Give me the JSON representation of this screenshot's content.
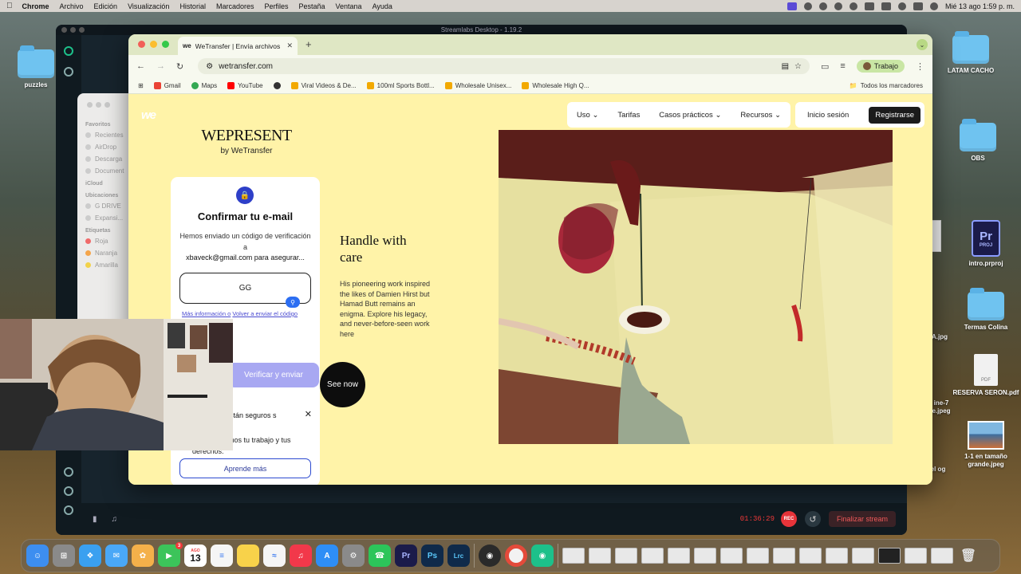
{
  "menubar": {
    "app": "Chrome",
    "items": [
      "Archivo",
      "Edición",
      "Visualización",
      "Historial",
      "Marcadores",
      "Perfiles",
      "Pestaña",
      "Ventana",
      "Ayuda"
    ],
    "clock": "Mié 13 ago 1:59 p. m."
  },
  "desktop": {
    "left_icons": [
      {
        "label": "puzzles"
      }
    ],
    "right_icons": [
      {
        "label": "LATAM CACHO"
      },
      {
        "label": "OBS"
      },
      {
        "label": "intro.prproj"
      },
      {
        "label": "Termas Colina"
      },
      {
        "label": "RESERVA SERON.pdf"
      },
      {
        "label": "1-1 en tamaño grande.jpeg"
      }
    ],
    "partial_labels": [
      "A.jpg",
      "ine-7 e.jpeg",
      "el og"
    ]
  },
  "prfile": {
    "badge": "Pr",
    "sub": "PROJ"
  },
  "pdf_badge": "PDF",
  "streamlabs": {
    "title": "Streamlabs Desktop - 1.19.2",
    "timer": "01:36:29",
    "rec": "REC",
    "end_button": "Finalizar stream"
  },
  "finder": {
    "sections": [
      {
        "heading": "Favoritos",
        "items": [
          "Recientes",
          "AirDrop",
          "Descarga",
          "Document"
        ]
      },
      {
        "heading": "iCloud",
        "items": []
      },
      {
        "heading": "Ubicaciones",
        "items": [
          "G DRIVE",
          "Expansi..."
        ]
      },
      {
        "heading": "Etiquetas",
        "items": [
          "Roja",
          "Naranja",
          "Amarilla"
        ]
      }
    ],
    "tag_colors": [
      "#f06a6a",
      "#f5a54a",
      "#f2d24a"
    ]
  },
  "chrome": {
    "tab_logo": "we",
    "tab_title": "WeTransfer | Envía archivos gr",
    "url": "wetransfer.com",
    "profile": "Trabajo",
    "bookmarks": [
      {
        "label": "Gmail",
        "color": "#ea4335"
      },
      {
        "label": "Maps",
        "color": "#34a853"
      },
      {
        "label": "YouTube",
        "color": "#ff0000"
      },
      {
        "label": "",
        "color": "#333333"
      },
      {
        "label": "Viral Videos & De...",
        "color": "#f2a900"
      },
      {
        "label": "100ml Sports Bottl...",
        "color": "#f2a900"
      },
      {
        "label": "Wholesale Unisex...",
        "color": "#f2a900"
      },
      {
        "label": "Wholesale High Q...",
        "color": "#f2a900"
      }
    ],
    "all_bookmarks": "Todos los marcadores"
  },
  "site": {
    "logo": "we",
    "nav": [
      {
        "label": "Uso",
        "dropdown": true
      },
      {
        "label": "Tarifas",
        "dropdown": false
      },
      {
        "label": "Casos prácticos",
        "dropdown": true
      },
      {
        "label": "Recursos",
        "dropdown": true
      }
    ],
    "login": "Inicio sesión",
    "register": "Registrarse",
    "wepresent": "WEPRESENT",
    "wepresent_by": "by WeTransfer",
    "card": {
      "title": "Confirmar tu e-mail",
      "body": "Hemos enviado un código de verificación a",
      "email": "xbaveck@gmail.com para asegurar...",
      "code_value": "GG",
      "link_more": "Más información o",
      "link_resend": "Volver a enviar el código",
      "verify_button": "Verificar y enviar"
    },
    "cookie": {
      "line1": "s están seguros s",
      "line2": "fer, respetamos tu trabajo y tus derechos.",
      "learn_more": "Aprende más"
    },
    "article": {
      "title": "Handle with care",
      "description": "His pioneering work inspired the likes of Damien Hirst but Hamad Butt remains an enigma. Explore his legacy, and never-before-seen work here",
      "cta": "See now"
    }
  },
  "dock": {
    "calendar_month": "AGO",
    "calendar_day": "13",
    "facetime_badge": "3",
    "apps": [
      {
        "id": "finder",
        "label": "",
        "color": "#3d8ef0"
      },
      {
        "id": "launchpad",
        "label": "",
        "color": "#8a8a8a"
      },
      {
        "id": "safari",
        "label": "",
        "color": "#3aa0f0"
      },
      {
        "id": "mail",
        "label": "",
        "color": "#4aa8f7"
      },
      {
        "id": "photos",
        "label": "",
        "color": "#f4b04a"
      },
      {
        "id": "facetime",
        "label": "",
        "color": "#3cc45a"
      },
      {
        "id": "calendar",
        "label": "",
        "color": "#ffffff"
      },
      {
        "id": "reminders",
        "label": "",
        "color": "#f5f5f5"
      },
      {
        "id": "notes",
        "label": "",
        "color": "#f8d24a"
      },
      {
        "id": "freeform",
        "label": "",
        "color": "#f5f5f5"
      },
      {
        "id": "music",
        "label": "",
        "color": "#f2384a"
      },
      {
        "id": "appstore",
        "label": "",
        "color": "#2e8ef6"
      },
      {
        "id": "settings",
        "label": "",
        "color": "#8a8a8a"
      },
      {
        "id": "whatsapp",
        "label": "",
        "color": "#2cc55a"
      },
      {
        "id": "premiere",
        "label": "Pr",
        "color": "#1b1b4a"
      },
      {
        "id": "photoshop",
        "label": "Ps",
        "color": "#0f2a4a"
      },
      {
        "id": "lightroom",
        "label": "Lrc",
        "color": "#0f2a4a"
      },
      {
        "id": "obs",
        "label": "",
        "color": "#2a2a2a"
      },
      {
        "id": "chrome",
        "label": "",
        "color": "#f2f2f2"
      },
      {
        "id": "streamlabs",
        "label": "",
        "color": "#1dc08a"
      }
    ],
    "minimized_count": 15
  }
}
